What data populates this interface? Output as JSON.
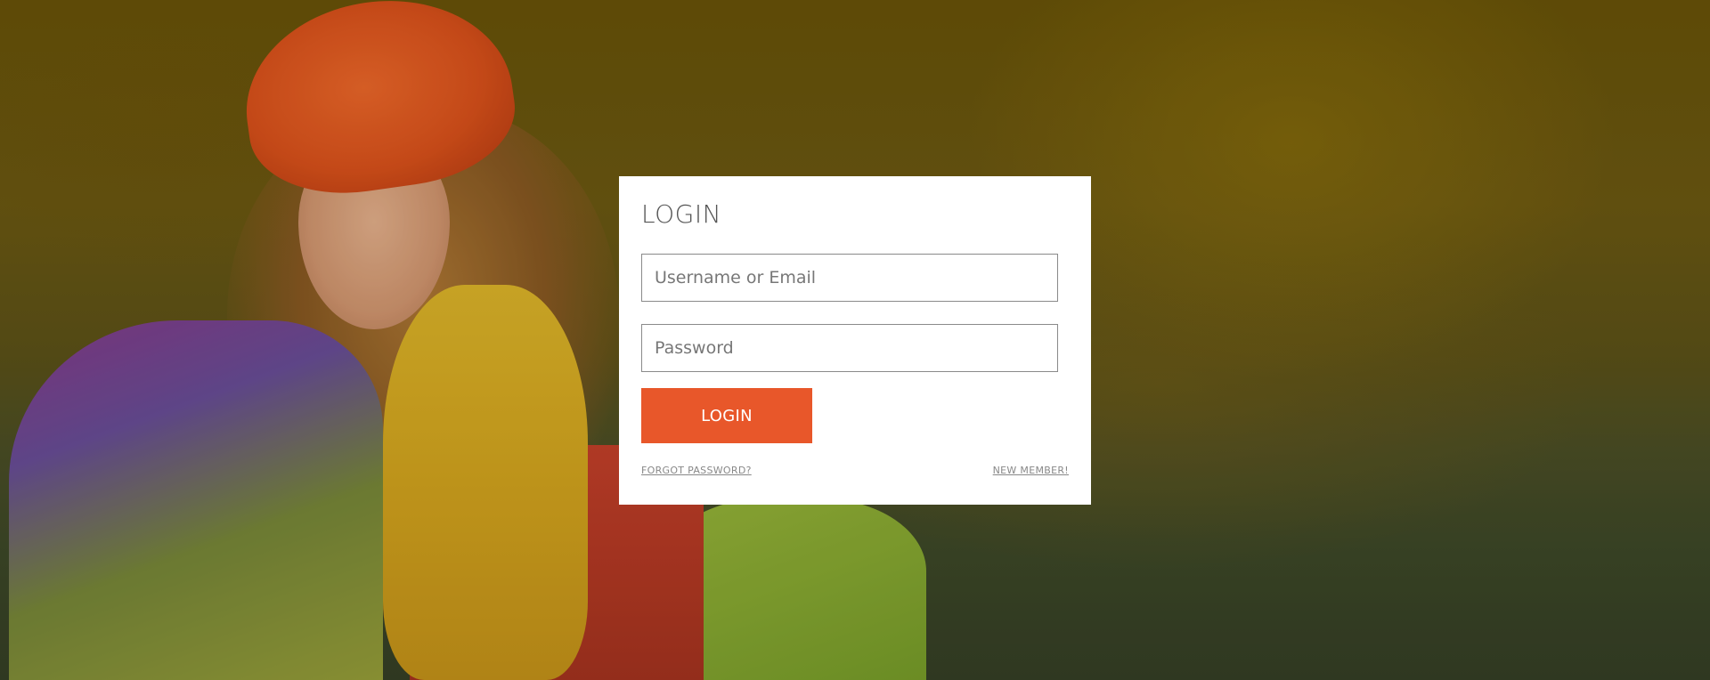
{
  "login": {
    "title": "LOGIN",
    "username_placeholder": "Username or Email",
    "password_placeholder": "Password",
    "submit_label": "LOGIN",
    "forgot_password_label": "FORGOT PASSWORD?",
    "new_member_label": "NEW MEMBER!"
  },
  "colors": {
    "accent": "#e8572a",
    "card_background": "#ffffff"
  }
}
